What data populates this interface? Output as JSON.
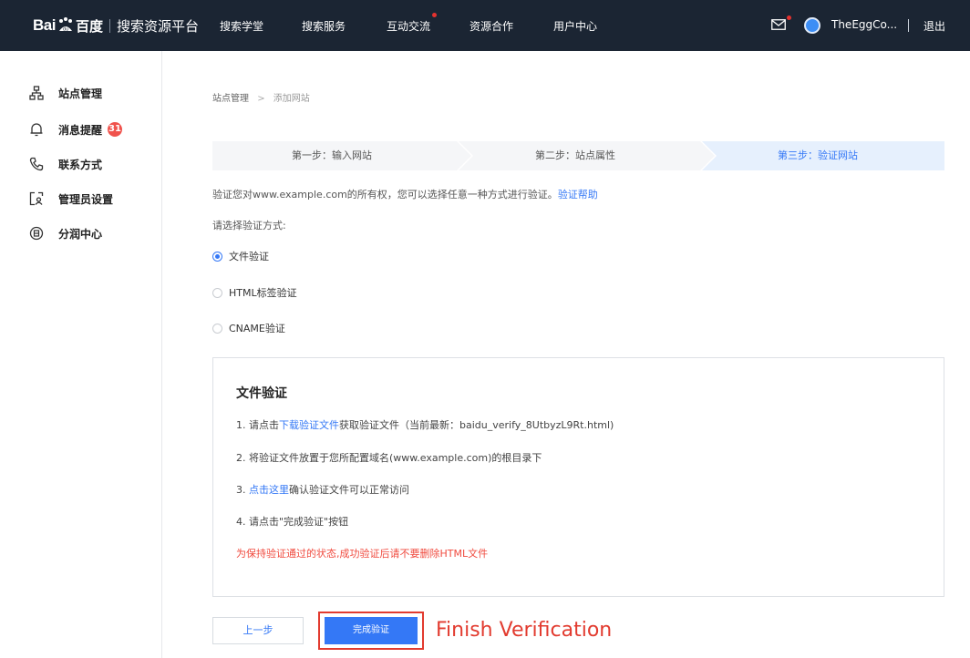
{
  "header": {
    "logo_bai": "Bai",
    "logo_du": "百度",
    "platform": "搜索资源平台",
    "nav": [
      "搜索学堂",
      "搜索服务",
      "互动交流",
      "资源合作",
      "用户中心"
    ],
    "username": "TheEggCo...",
    "logout": "退出"
  },
  "sidebar": {
    "items": [
      {
        "label": "站点管理",
        "icon": "sitemap-icon"
      },
      {
        "label": "消息提醒",
        "icon": "bell-icon",
        "badge": "31"
      },
      {
        "label": "联系方式",
        "icon": "phone-icon"
      },
      {
        "label": "管理员设置",
        "icon": "admin-icon"
      },
      {
        "label": "分润中心",
        "icon": "revenue-icon"
      }
    ]
  },
  "breadcrumb": {
    "root": "站点管理",
    "sep": ">",
    "current": "添加网站"
  },
  "steps": [
    "第一步：输入网站",
    "第二步：站点属性",
    "第三步：验证网站"
  ],
  "description": {
    "text": "验证您对www.example.com的所有权，您可以选择任意一种方式进行验证。",
    "link": "验证帮助"
  },
  "choose_label": "请选择验证方式:",
  "methods": [
    "文件验证",
    "HTML标签验证",
    "CNAME验证"
  ],
  "panel": {
    "title": "文件验证",
    "step1_prefix": "1.  请点击",
    "step1_link": "下载验证文件",
    "step1_suffix": "获取验证文件（当前最新：baidu_verify_8UtbyzL9Rt.html)",
    "step2": "2.  将验证文件放置于您所配置域名(www.example.com)的根目录下",
    "step3_prefix": "3.  ",
    "step3_link": "点击这里",
    "step3_suffix": "确认验证文件可以正常访问",
    "step4": "4.  请点击\"完成验证\"按钮",
    "warning": "为保持验证通过的状态,成功验证后请不要删除HTML文件"
  },
  "buttons": {
    "prev": "上一步",
    "done": "完成验证"
  },
  "annotation": "Finish Verification",
  "colors": {
    "topbar": "#1b2533",
    "accent": "#3478f6",
    "annotation": "#e23b2f",
    "active_step_bg": "#e6f0fd"
  }
}
